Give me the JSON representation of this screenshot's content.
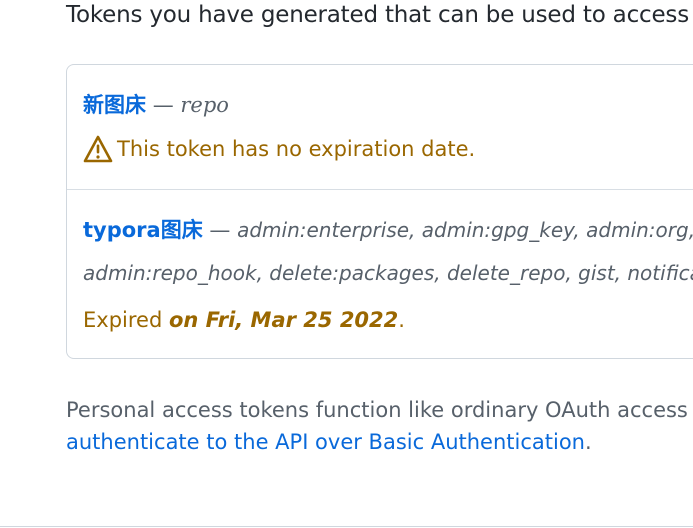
{
  "intro": {
    "text": "Tokens you have generated that can be used to access th"
  },
  "tokens": [
    {
      "name": "新图床",
      "separator": "—",
      "scopes_line1": "repo",
      "warning": "This token has no expiration date."
    },
    {
      "name": "typora图床",
      "separator": "—",
      "scopes_line1": "admin:enterprise, admin:gpg_key, admin:org, admi",
      "scopes_line2": "admin:repo_hook, delete:packages, delete_repo, gist, notifications,",
      "expired_prefix": "Expired",
      "expired_date": "on Fri, Mar 25 2022",
      "expired_suffix": "."
    }
  ],
  "footer": {
    "line1": "Personal access tokens function like ordinary OAuth access tokens",
    "link": "authenticate to the API over Basic Authentication",
    "link_suffix": "."
  },
  "icons": {
    "warning": "alert-icon"
  },
  "colors": {
    "link": "#0969da",
    "attention": "#9a6700",
    "muted": "#57606a",
    "text": "#24292f",
    "border": "#d0d7de"
  }
}
